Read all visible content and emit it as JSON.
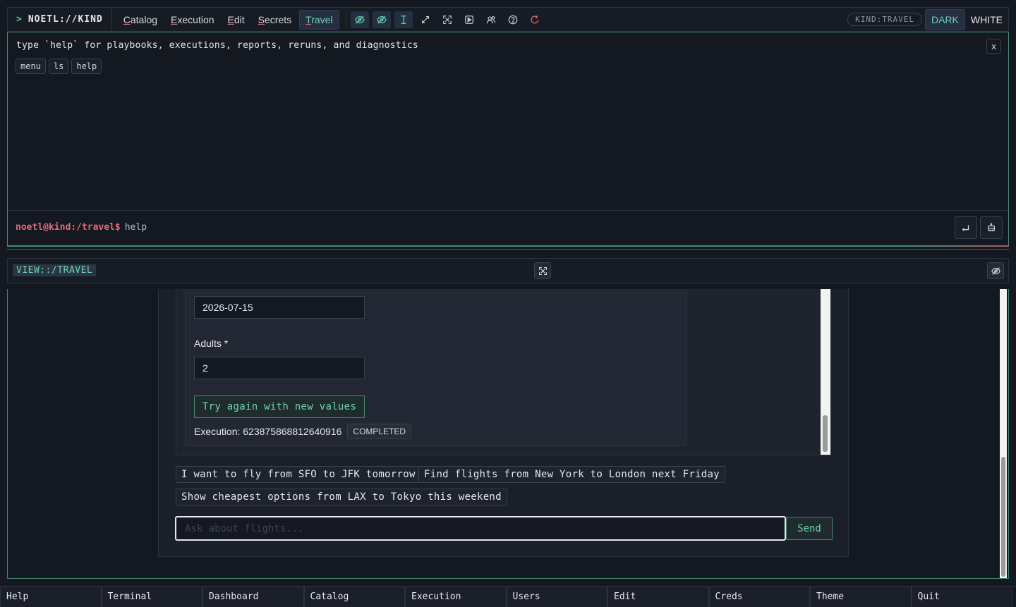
{
  "topbar": {
    "brand_prefix": ">",
    "brand": "NOETL://KIND",
    "menu": [
      {
        "key": "C",
        "rest": "atalog",
        "active": false
      },
      {
        "key": "E",
        "rest": "xecution",
        "active": false
      },
      {
        "key": "E",
        "rest": "dit",
        "active": false
      },
      {
        "key": "S",
        "rest": "ecrets",
        "active": false
      },
      {
        "key": "T",
        "rest": "ravel",
        "active": true
      }
    ],
    "tools": [
      "eye-off-icon",
      "eye-off-icon",
      "text-cursor-icon",
      "expand-diagonal-icon",
      "fullscreen-icon",
      "play-icon",
      "users-icon",
      "help-circle-icon",
      "refresh-icon"
    ],
    "kind_badge": "KIND:TRAVEL",
    "theme_dark": "DARK",
    "theme_white": "WHITE"
  },
  "terminal": {
    "info": "type `help` for playbooks, executions, reports, reruns, and diagnostics",
    "close": "x",
    "chips": [
      "menu",
      "ls",
      "help"
    ],
    "prompt": "noetl@kind:/travel$",
    "command": "help"
  },
  "view": {
    "label": "VIEW::/TRAVEL"
  },
  "form": {
    "date_value": "2026-07-15",
    "adults_label": "Adults *",
    "adults_value": "2",
    "retry_label": "Try again with new values",
    "execution_label": "Execution: 623875868812640916",
    "status": "COMPLETED"
  },
  "suggestions": [
    "I want to fly from SFO to JFK tomorrow",
    "Find flights from New York to London next Friday",
    "Show cheapest options from LAX to Tokyo this weekend"
  ],
  "chat": {
    "placeholder": "Ask about flights...",
    "send_label": "Send"
  },
  "bottombar": [
    "Help",
    "Terminal",
    "Dashboard",
    "Catalog",
    "Execution",
    "Users",
    "Edit",
    "Creds",
    "Theme",
    "Quit"
  ],
  "colors": {
    "accent": "#6fd1b5",
    "prompt": "#e06c75",
    "background": "#141821"
  }
}
